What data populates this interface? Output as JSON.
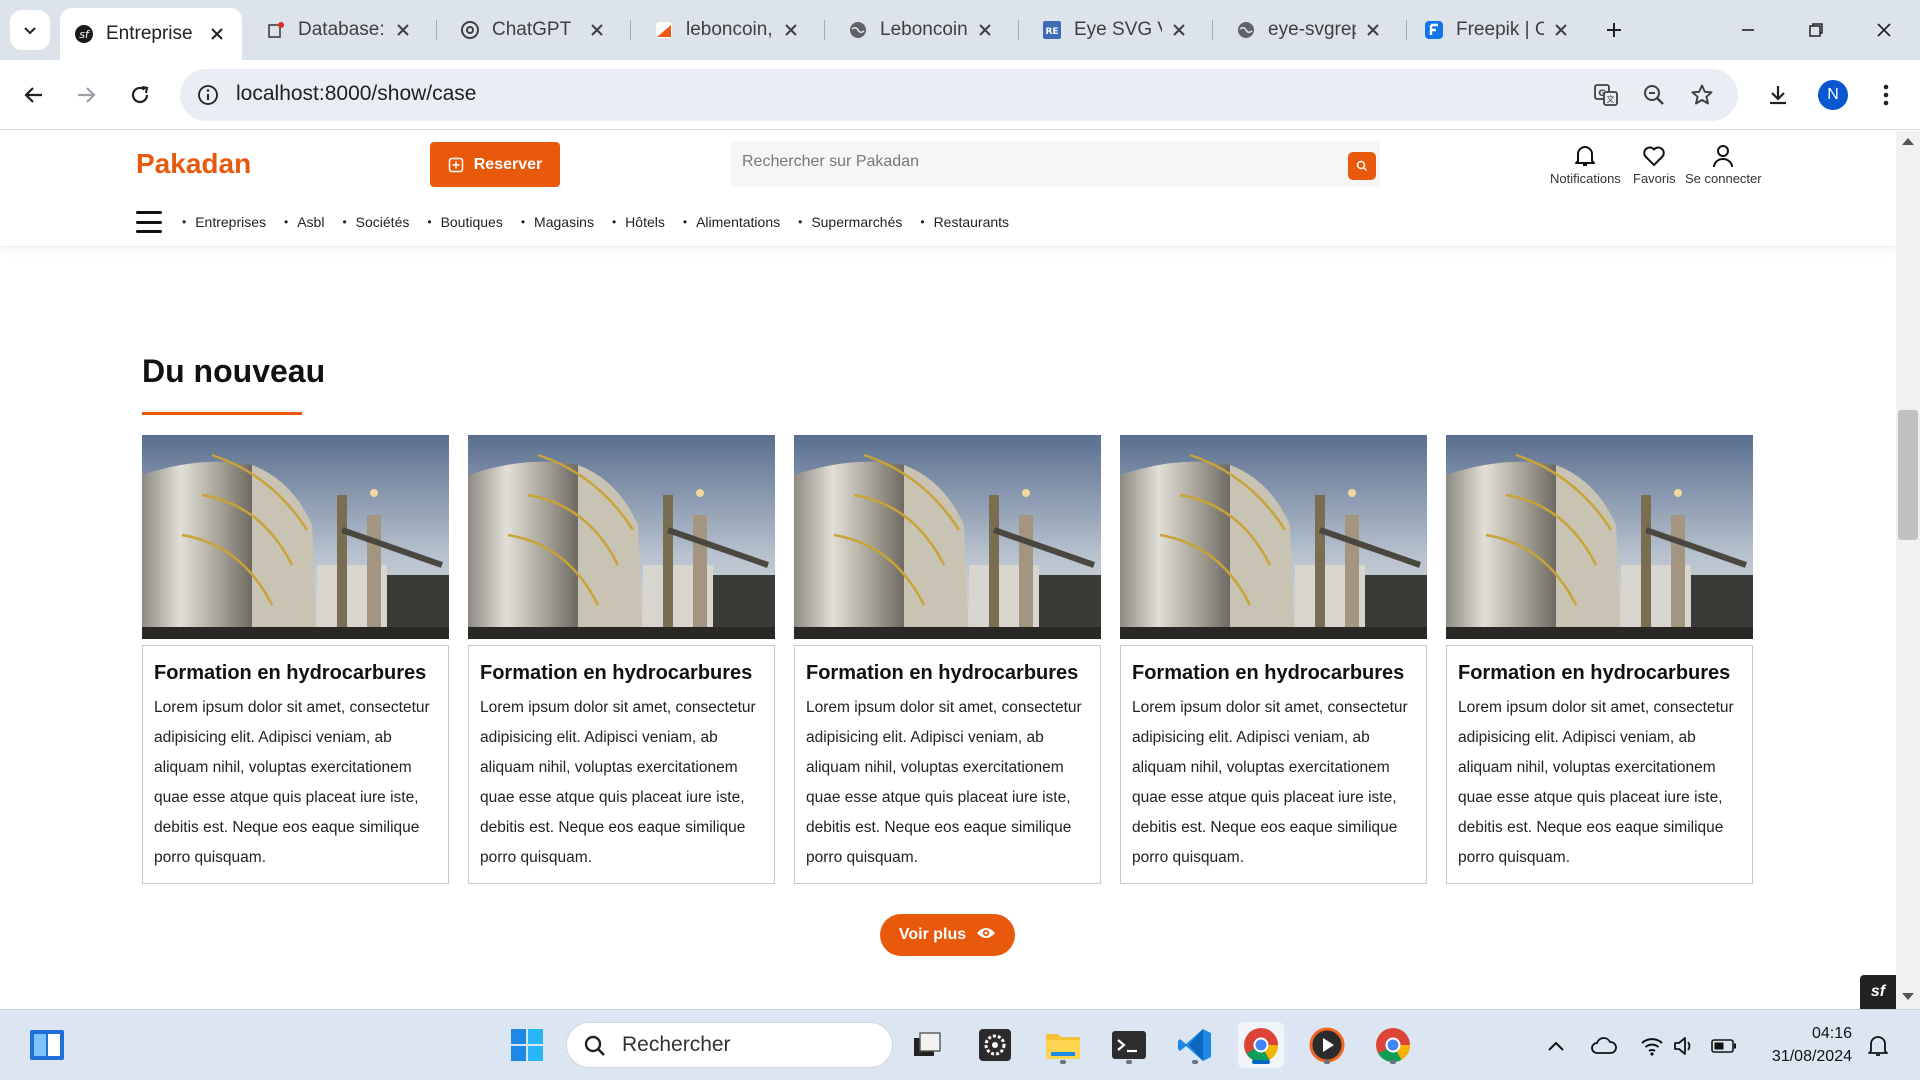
{
  "browser": {
    "tabs": [
      {
        "title": "Entreprise",
        "favicon": "symfony-icon",
        "active": true
      },
      {
        "title": "Database:",
        "favicon": "database-icon",
        "active": false
      },
      {
        "title": "ChatGPT",
        "favicon": "chatgpt-icon",
        "active": false
      },
      {
        "title": "leboncoin,",
        "favicon": "leboncoin-icon",
        "active": false
      },
      {
        "title": "Leboncoin",
        "favicon": "globe-icon",
        "active": false
      },
      {
        "title": "Eye SVG V",
        "favicon": "svgrepo-icon",
        "active": false
      },
      {
        "title": "eye-svgrep",
        "favicon": "globe-icon",
        "active": false
      },
      {
        "title": "Freepik | C",
        "favicon": "freepik-icon",
        "active": false
      }
    ],
    "url": "localhost:8000/show/case",
    "profile_initial": "N"
  },
  "site": {
    "logo": "Pakadan",
    "reserve_label": "Reserver",
    "search_placeholder": "Rechercher sur Pakadan",
    "actions": [
      {
        "label": "Notifications",
        "icon": "bell-icon"
      },
      {
        "label": "Favoris",
        "icon": "heart-icon"
      },
      {
        "label": "Se connecter",
        "icon": "user-icon"
      }
    ],
    "categories": [
      "Entreprises",
      "Asbl",
      "Sociétés",
      "Boutiques",
      "Magasins",
      "Hôtels",
      "Alimentations",
      "Supermarchés",
      "Restaurants"
    ],
    "section_title": "Du nouveau",
    "cards": [
      {
        "title": "Formation en hydrocarbures",
        "text": "Lorem ipsum dolor sit amet, consectetur adipisicing elit. Adipisci veniam, ab aliquam nihil, voluptas exercitationem quae esse atque quis placeat iure iste, debitis est. Neque eos eaque similique porro quisquam."
      },
      {
        "title": "Formation en hydrocarbures",
        "text": "Lorem ipsum dolor sit amet, consectetur adipisicing elit. Adipisci veniam, ab aliquam nihil, voluptas exercitationem quae esse atque quis placeat iure iste, debitis est. Neque eos eaque similique porro quisquam."
      },
      {
        "title": "Formation en hydrocarbures",
        "text": "Lorem ipsum dolor sit amet, consectetur adipisicing elit. Adipisci veniam, ab aliquam nihil, voluptas exercitationem quae esse atque quis placeat iure iste, debitis est. Neque eos eaque similique porro quisquam."
      },
      {
        "title": "Formation en hydrocarbures",
        "text": "Lorem ipsum dolor sit amet, consectetur adipisicing elit. Adipisci veniam, ab aliquam nihil, voluptas exercitationem quae esse atque quis placeat iure iste, debitis est. Neque eos eaque similique porro quisquam."
      },
      {
        "title": "Formation en hydrocarbures",
        "text": "Lorem ipsum dolor sit amet, consectetur adipisicing elit. Adipisci veniam, ab aliquam nihil, voluptas exercitationem quae esse atque quis placeat iure iste, debitis est. Neque eos eaque similique porro quisquam."
      }
    ],
    "more_label": "Voir plus",
    "colors": {
      "accent": "#e8590c"
    }
  },
  "taskbar": {
    "search_placeholder": "Rechercher",
    "time": "04:16",
    "date": "31/08/2024"
  }
}
